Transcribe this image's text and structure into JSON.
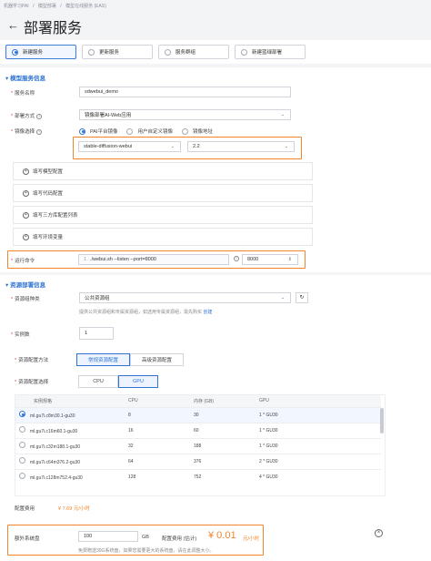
{
  "breadcrumb": [
    "机器学习PAI",
    "/",
    "模型部署",
    "/",
    "模型在线服务 (EAS)"
  ],
  "page_title": "部署服务",
  "mode_options": [
    {
      "label": "新建服务",
      "selected": true
    },
    {
      "label": "更新服务",
      "selected": false
    },
    {
      "label": "服务群组",
      "selected": false
    },
    {
      "label": "新建蓝绿部署",
      "selected": false
    }
  ],
  "model_section": {
    "title": "模型服务信息",
    "service_name_label": "服务名称",
    "service_name_value": "sdwebui_demo",
    "deploy_method_label": "部署方式",
    "deploy_method_value": "镜像部署AI-Web应用",
    "image_label": "镜像选择",
    "image_options": [
      {
        "label": "PAI平台镜像",
        "selected": true
      },
      {
        "label": "用户自定义镜像",
        "selected": false
      },
      {
        "label": "镜像地址",
        "selected": false
      }
    ],
    "image_name": "stable-diffusion-webui",
    "image_version": "2.2",
    "expanders": [
      "填写模型配置",
      "填写代码配置",
      "填写三方库配置列表",
      "填写环境变量"
    ],
    "command_label": "运行命令",
    "command_line_no": "1",
    "command_value": "./webui.sh --listen --port=8000",
    "port_value": "8000"
  },
  "resource_section": {
    "title": "资源部署信息",
    "group_type_label": "资源组种类",
    "group_type_value": "公共资源组",
    "group_hint": "提供公共资源组和专属资源组，如选用专属资源组，需先购买",
    "group_hint_link": "创建",
    "instances_label": "实例数",
    "instances_value": "1",
    "config_method_label": "资源配置方法",
    "config_tabs": [
      {
        "label": "常规资源配置",
        "selected": true
      },
      {
        "label": "高级资源配置",
        "selected": false
      }
    ],
    "config_select_label": "资源配置选择",
    "cpu_gpu_tabs": [
      {
        "label": "CPU",
        "selected": false
      },
      {
        "label": "GPU",
        "selected": true
      }
    ],
    "table_headers": [
      "实例规格",
      "CPU",
      "内存 (GB)",
      "GPU"
    ],
    "table_rows": [
      {
        "spec": "ml.gu7i.c8m30.1-gu30",
        "cpu": "8",
        "mem": "30",
        "gpu": "1 * GU30",
        "selected": true
      },
      {
        "spec": "ml.gu7i.c16m60.1-gu30",
        "cpu": "16",
        "mem": "60",
        "gpu": "1 * GU30",
        "selected": false
      },
      {
        "spec": "ml.gu7i.c32m188.1-gu30",
        "cpu": "32",
        "mem": "188",
        "gpu": "1 * GU30",
        "selected": false
      },
      {
        "spec": "ml.gu7i.c64m376.2-gu30",
        "cpu": "64",
        "mem": "376",
        "gpu": "2 * GU30",
        "selected": false
      },
      {
        "spec": "ml.gu7i.c128m752.4-gu30",
        "cpu": "128",
        "mem": "752",
        "gpu": "4 * GU30",
        "selected": false
      }
    ],
    "config_cost_label": "配置费用",
    "config_cost_value": "¥ 7.69 元/小时",
    "disk_label": "额外系统盘",
    "disk_value": "100",
    "disk_unit": "GB",
    "disk_cost_label": "配置费用 (估计)",
    "disk_cost_value": "¥ 0.01",
    "disk_cost_unit": "元/小时",
    "disk_hint": "免费赠送30G系统盘，如果您需要更大的系统盘，请在此调整大小。"
  }
}
